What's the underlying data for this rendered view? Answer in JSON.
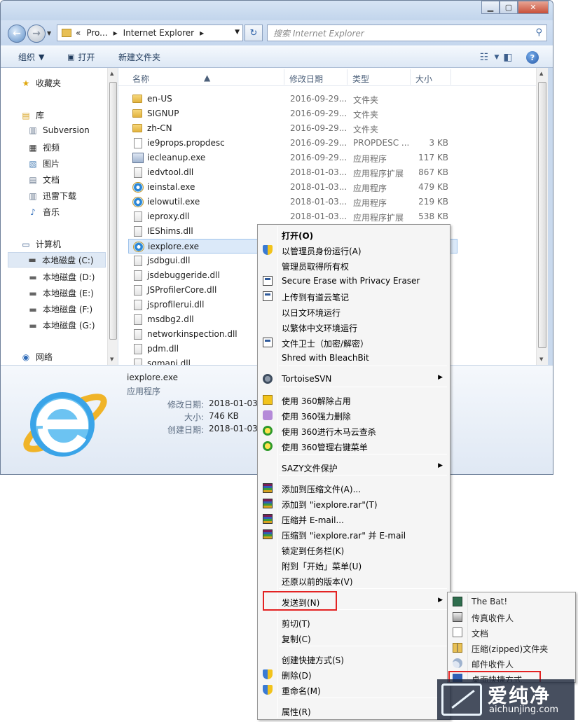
{
  "window": {
    "address": {
      "chevron": "«",
      "segments": [
        "Pro...",
        "Internet Explorer"
      ]
    },
    "search_placeholder": "搜索 Internet Explorer",
    "toolbar": {
      "organize": "组织",
      "open": "打开",
      "new_folder": "新建文件夹"
    }
  },
  "nav_pane": {
    "favorites": "收藏夹",
    "libraries": "库",
    "library_items": [
      "Subversion",
      "视频",
      "图片",
      "文档",
      "迅雷下载",
      "音乐"
    ],
    "computer": "计算机",
    "drives": [
      "本地磁盘 (C:)",
      "本地磁盘 (D:)",
      "本地磁盘 (E:)",
      "本地磁盘 (F:)",
      "本地磁盘 (G:)"
    ],
    "network": "网络"
  },
  "columns": {
    "name": "名称",
    "date": "修改日期",
    "type": "类型",
    "size": "大小"
  },
  "files": [
    {
      "name": "en-US",
      "date": "2016-09-29...",
      "type": "文件夹",
      "size": "",
      "icon": "folder-icon"
    },
    {
      "name": "SIGNUP",
      "date": "2016-09-29...",
      "type": "文件夹",
      "size": "",
      "icon": "folder-icon"
    },
    {
      "name": "zh-CN",
      "date": "2016-09-29...",
      "type": "文件夹",
      "size": "",
      "icon": "folder-icon"
    },
    {
      "name": "ie9props.propdesc",
      "date": "2016-09-29...",
      "type": "PROPDESC ...",
      "size": "3 KB",
      "icon": "file-icon"
    },
    {
      "name": "iecleanup.exe",
      "date": "2016-09-29...",
      "type": "应用程序",
      "size": "117 KB",
      "icon": "exe-icon"
    },
    {
      "name": "iedvtool.dll",
      "date": "2018-01-03...",
      "type": "应用程序扩展",
      "size": "867 KB",
      "icon": "dll-icon"
    },
    {
      "name": "ieinstal.exe",
      "date": "2018-01-03...",
      "type": "应用程序",
      "size": "479 KB",
      "icon": "ie-icon"
    },
    {
      "name": "ielowutil.exe",
      "date": "2018-01-03...",
      "type": "应用程序",
      "size": "219 KB",
      "icon": "ie-icon"
    },
    {
      "name": "ieproxy.dll",
      "date": "2018-01-03...",
      "type": "应用程序扩展",
      "size": "538 KB",
      "icon": "dll-icon"
    },
    {
      "name": "IEShims.dll",
      "date": "",
      "type": "",
      "size": "",
      "icon": "dll-icon"
    },
    {
      "name": "iexplore.exe",
      "date": "",
      "type": "",
      "size": "",
      "icon": "ie-icon"
    },
    {
      "name": "jsdbgui.dll",
      "date": "",
      "type": "",
      "size": "",
      "icon": "dll-icon"
    },
    {
      "name": "jsdebuggeride.dll",
      "date": "",
      "type": "",
      "size": "",
      "icon": "dll-icon"
    },
    {
      "name": "JSProfilerCore.dll",
      "date": "",
      "type": "",
      "size": "",
      "icon": "dll-icon"
    },
    {
      "name": "jsprofilerui.dll",
      "date": "",
      "type": "",
      "size": "",
      "icon": "dll-icon"
    },
    {
      "name": "msdbg2.dll",
      "date": "",
      "type": "",
      "size": "",
      "icon": "dll-icon"
    },
    {
      "name": "networkinspection.dll",
      "date": "",
      "type": "",
      "size": "",
      "icon": "dll-icon"
    },
    {
      "name": "pdm.dll",
      "date": "",
      "type": "",
      "size": "",
      "icon": "dll-icon"
    },
    {
      "name": "sqmapi.dll",
      "date": "",
      "type": "",
      "size": "",
      "icon": "dll-icon"
    }
  ],
  "details": {
    "filename": "iexplore.exe",
    "filetype": "应用程序",
    "modified_label": "修改日期:",
    "modified_value": "2018-01-03",
    "size_label": "大小:",
    "size_value": "746 KB",
    "created_label": "创建日期:",
    "created_value": "2018-01-03"
  },
  "context_menu": {
    "items": [
      "打开(O)",
      "以管理员身份运行(A)",
      "管理员取得所有权",
      "Secure Erase with Privacy Eraser",
      "上传到有道云笔记",
      "以日文环境运行",
      "以繁体中文环境运行",
      "文件卫士（加密/解密）",
      "Shred with BleachBit",
      "TortoiseSVN",
      "使用 360解除占用",
      "使用 360强力删除",
      "使用 360进行木马云查杀",
      "使用 360管理右键菜单",
      "SAZY文件保护",
      "添加到压缩文件(A)...",
      "添加到 \"iexplore.rar\"(T)",
      "压缩并 E-mail...",
      "压缩到 \"iexplore.rar\" 并 E-mail",
      "锁定到任务栏(K)",
      "附到「开始」菜单(U)",
      "还原以前的版本(V)",
      "发送到(N)",
      "剪切(T)",
      "复制(C)",
      "创建快捷方式(S)",
      "删除(D)",
      "重命名(M)",
      "属性(R)"
    ]
  },
  "send_to_menu": {
    "items": [
      "The Bat!",
      "传真收件人",
      "文档",
      "压缩(zipped)文件夹",
      "邮件收件人",
      "桌面快捷方式"
    ]
  },
  "highlight_color": "#e32222",
  "watermark": {
    "brand": "爱纯净",
    "url": "aichunjing.com"
  }
}
